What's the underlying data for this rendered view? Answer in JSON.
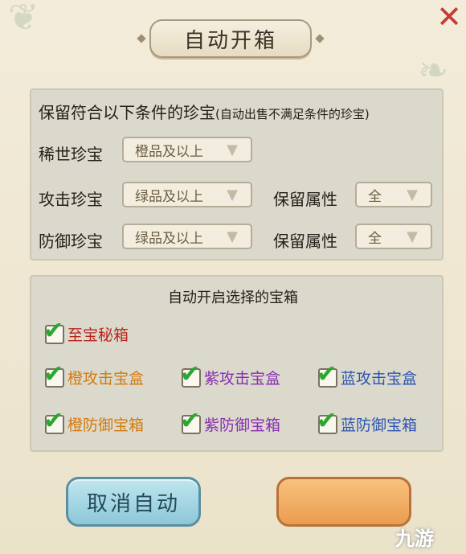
{
  "dialog": {
    "title": "自动开箱",
    "close_icon": "close-x-icon"
  },
  "filters": {
    "hint": "保留符合以下条件的珍宝",
    "hint_note": "(自动出售不满足条件的珍宝)",
    "rare": {
      "label": "稀世珍宝",
      "value": "橙品及以上"
    },
    "attack": {
      "label": "攻击珍宝",
      "value": "绿品及以上",
      "attr_label": "保留属性",
      "attr_value": "全"
    },
    "defense": {
      "label": "防御珍宝",
      "value": "绿品及以上",
      "attr_label": "保留属性",
      "attr_value": "全"
    }
  },
  "chests": {
    "title": "自动开启选择的宝箱",
    "items": [
      {
        "label": "至宝秘箱",
        "checked": true,
        "color": "#b8271f"
      },
      {
        "label": "橙攻击宝盒",
        "checked": true,
        "color": "#d47a10"
      },
      {
        "label": "紫攻击宝盒",
        "checked": true,
        "color": "#8b2fb3"
      },
      {
        "label": "蓝攻击宝盒",
        "checked": true,
        "color": "#2d55b0"
      },
      {
        "label": "橙防御宝箱",
        "checked": true,
        "color": "#d47a10"
      },
      {
        "label": "紫防御宝箱",
        "checked": true,
        "color": "#8b2fb3"
      },
      {
        "label": "蓝防御宝箱",
        "checked": true,
        "color": "#2d55b0"
      }
    ]
  },
  "buttons": {
    "cancel": "取消自动",
    "confirm": ""
  },
  "watermark": "九游"
}
